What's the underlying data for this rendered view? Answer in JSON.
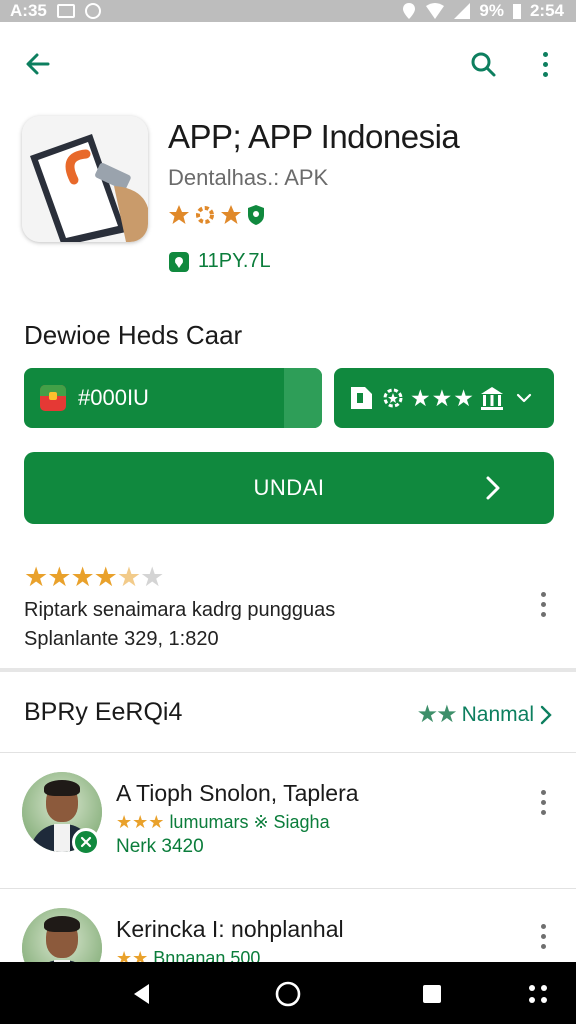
{
  "status_bar": {
    "time": "2:54",
    "left_text": "A:35",
    "battery_text": "9%"
  },
  "app": {
    "title": "APP; APP Indonesia",
    "developer": "Dentalhas.: APK",
    "size": "11PY.7L"
  },
  "section_label": "Dewioe Heds Caar",
  "price_selector": {
    "code": "#000IU"
  },
  "rating_selector": {
    "stars": "★★★"
  },
  "install_button": {
    "label": "UNDAI"
  },
  "rating": {
    "stars": 4.5,
    "stars_display": "★★★★★",
    "line1": "Riptark senaimara kadrg pungguas",
    "line2": "Splanlante 329, 1:820"
  },
  "section": {
    "title": "BPRy EeRQi4",
    "link_label": "Nanmal"
  },
  "list_items": [
    {
      "title": "A Tioph Snolon, Taplera",
      "stars": "★★★",
      "subtitle": "lumumars ※ Siagha",
      "meta": "Nerk 3420"
    },
    {
      "title": "Kerincka I: nohplanhal",
      "stars": "★★",
      "subtitle": "Bnnanan 500",
      "meta": ""
    }
  ],
  "colors": {
    "primary": "#10893e",
    "star": "#e9a12b",
    "accent_text": "#0d7f5f"
  },
  "icons": {
    "back": "arrow-left-icon",
    "search": "search-icon",
    "more": "kebab-icon",
    "nav_back": "triangle-back-icon",
    "nav_home": "circle-home-icon",
    "nav_recents": "square-recents-icon"
  }
}
